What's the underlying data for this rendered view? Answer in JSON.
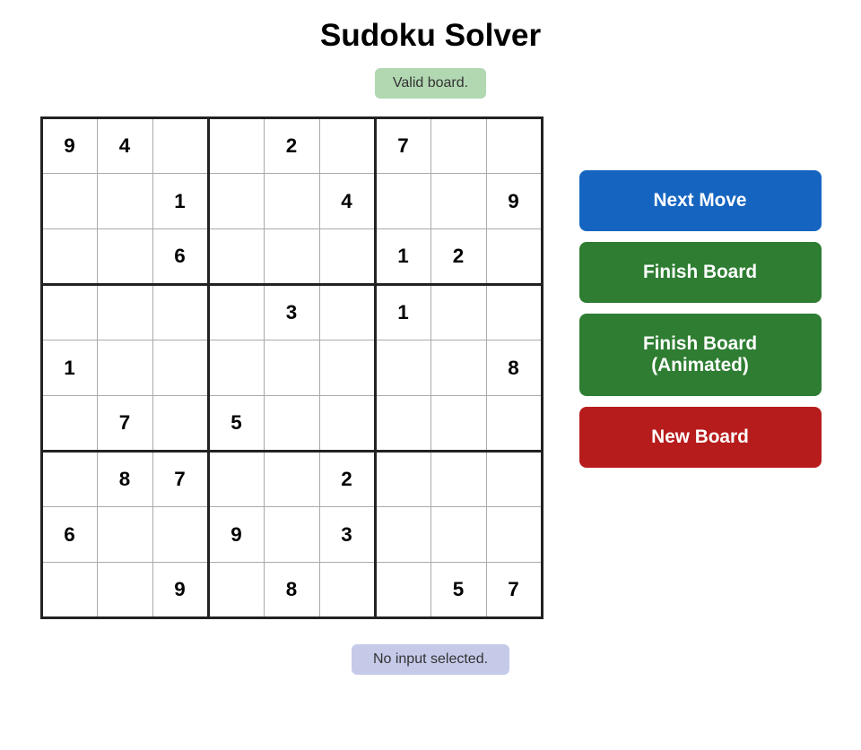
{
  "title": "Sudoku Solver",
  "status": "Valid board.",
  "bottom_status": "No input selected.",
  "buttons": {
    "next_move": "Next Move",
    "finish_board": "Finish Board",
    "finish_board_animated": "Finish Board\n(Animated)",
    "new_board": "New Board"
  },
  "grid": [
    [
      "9",
      "4",
      "",
      "",
      "2",
      "",
      "7",
      "",
      ""
    ],
    [
      "",
      "",
      "1",
      "",
      "",
      "4",
      "",
      "",
      "9"
    ],
    [
      "",
      "",
      "6",
      "",
      "",
      "",
      "1",
      "2",
      ""
    ],
    [
      "",
      "",
      "",
      "",
      "3",
      "",
      "1",
      "",
      ""
    ],
    [
      "1",
      "",
      "",
      "",
      "",
      "",
      "",
      "",
      "8"
    ],
    [
      "",
      "7",
      "",
      "5",
      "",
      "",
      "",
      "",
      ""
    ],
    [
      "",
      "8",
      "7",
      "",
      "",
      "2",
      "",
      "",
      ""
    ],
    [
      "6",
      "",
      "",
      "9",
      "",
      "3",
      "",
      "",
      ""
    ],
    [
      "",
      "",
      "9",
      "",
      "8",
      "",
      "",
      "5",
      "7"
    ]
  ]
}
